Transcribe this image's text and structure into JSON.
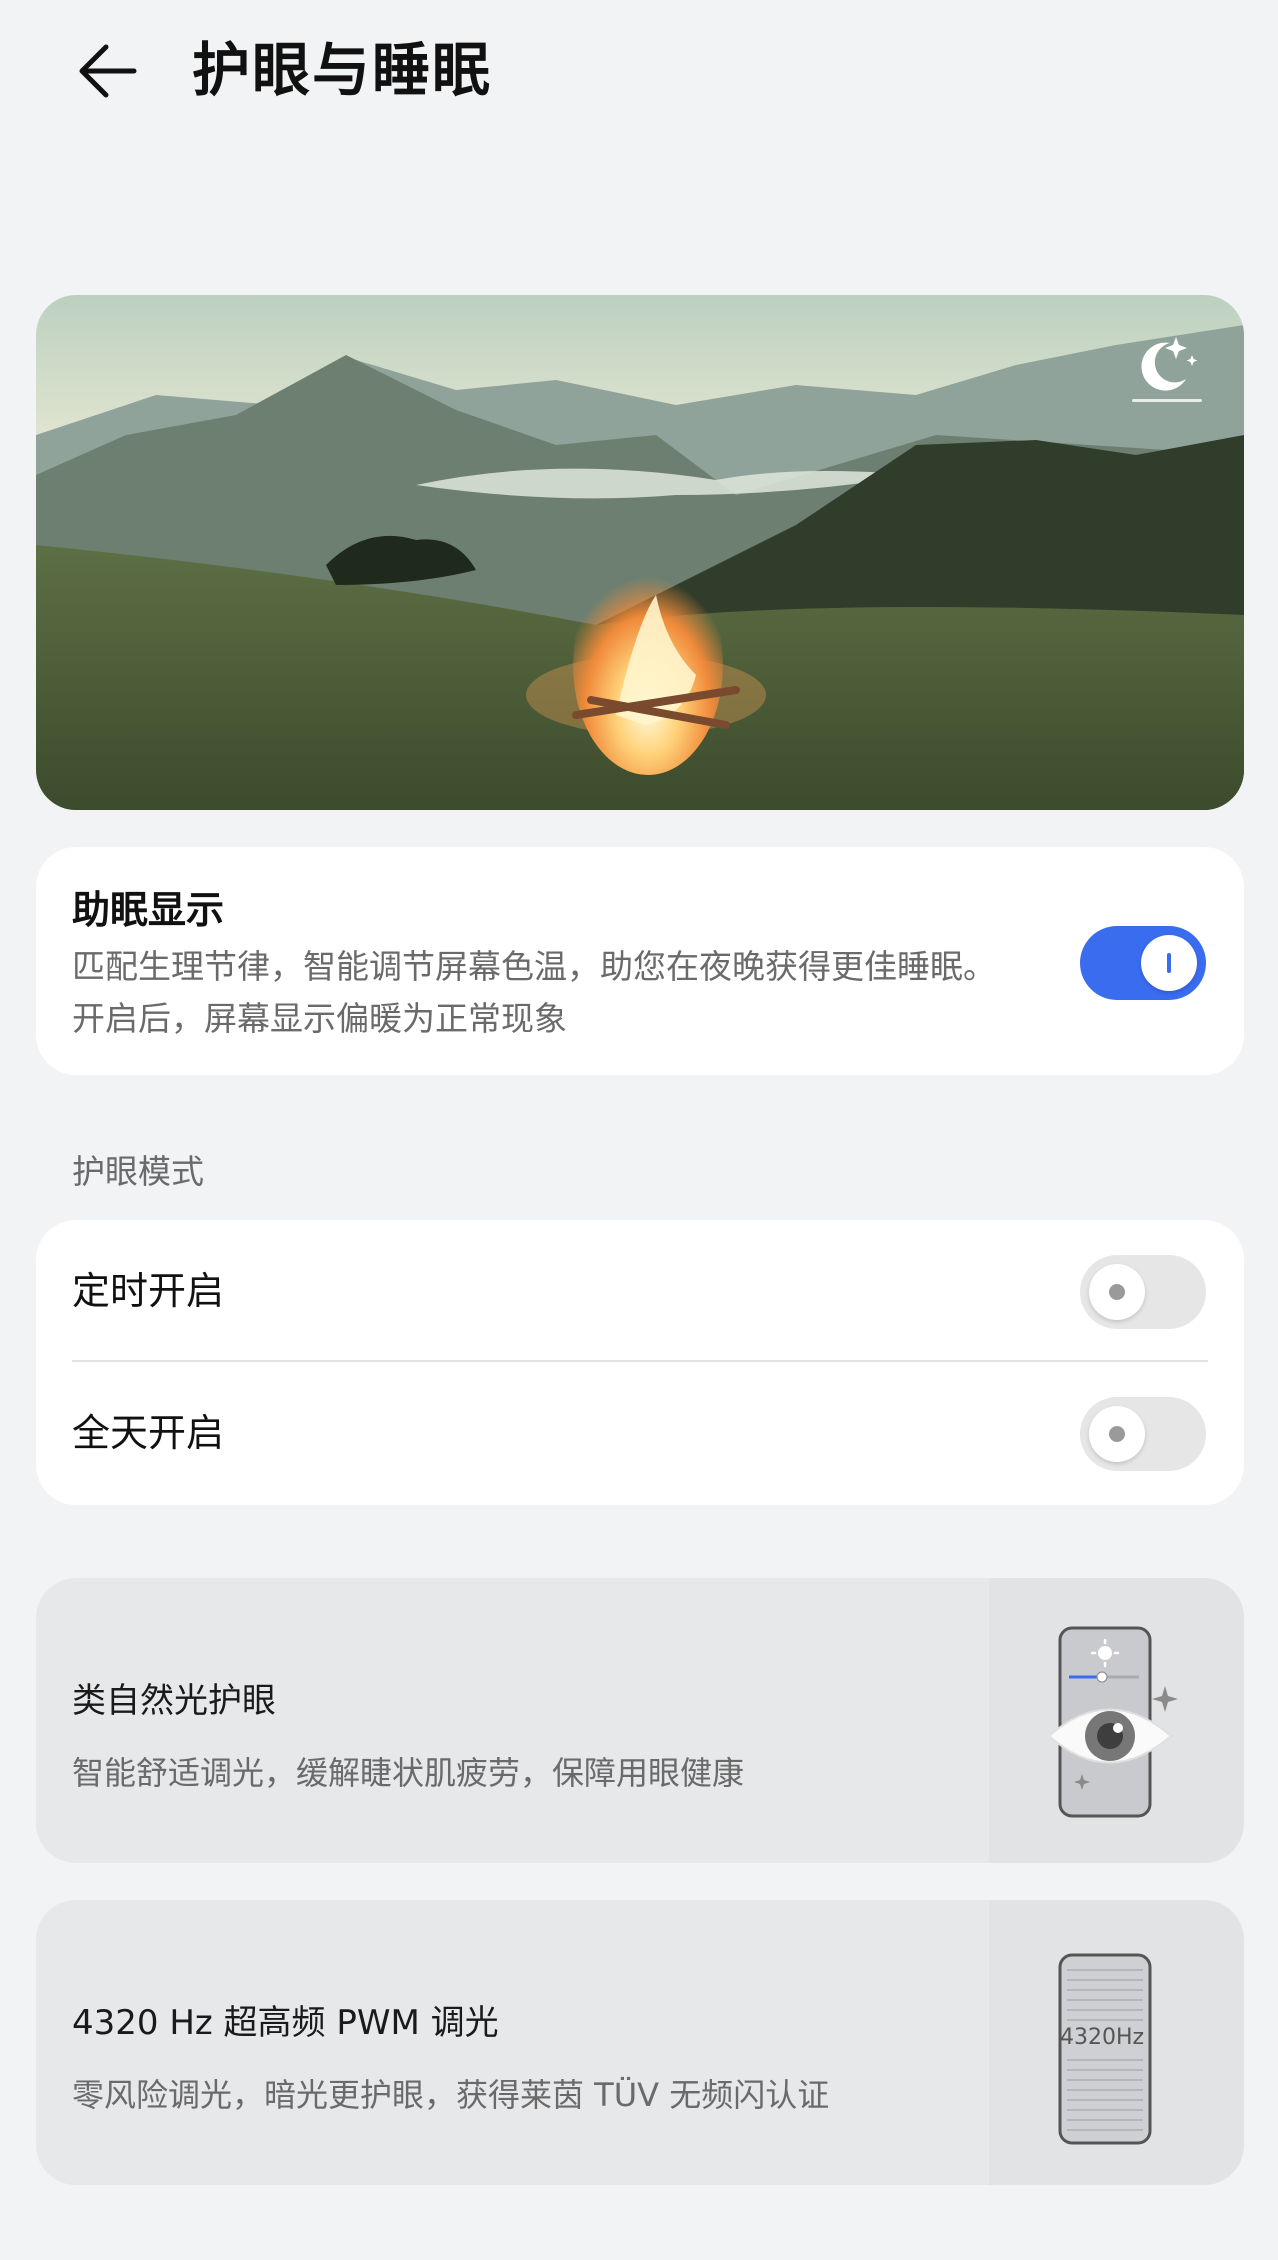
{
  "header": {
    "title": "护眼与睡眠"
  },
  "sleep_display": {
    "title": "助眠显示",
    "description_line1": "匹配生理节律，智能调节屏幕色温，助您在夜晚获得更佳睡眠。",
    "description_line2": "开启后，屏幕显示偏暖为正常现象",
    "enabled": true
  },
  "eye_mode": {
    "section_label": "护眼模式",
    "rows": [
      {
        "label": "定时开启",
        "enabled": false
      },
      {
        "label": "全天开启",
        "enabled": false
      }
    ]
  },
  "features": [
    {
      "title": "类自然光护眼",
      "description": "智能舒适调光，缓解睫状肌疲劳，保障用眼健康",
      "icon": "phone-eye-icon"
    },
    {
      "title": "4320 Hz 超高频 PWM 调光",
      "description": "零风险调光，暗光更护眼，获得莱茵 TÜV 无频闪认证",
      "icon": "phone-pwm-icon",
      "illustration_text": "4320Hz"
    }
  ],
  "colors": {
    "accent": "#3a6cf0",
    "background": "#f1f3f5"
  }
}
